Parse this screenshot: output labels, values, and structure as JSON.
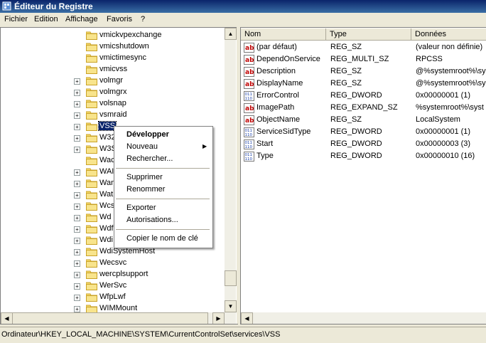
{
  "window": {
    "title": "Éditeur du Registre"
  },
  "menu": [
    "Fichier",
    "Edition",
    "Affichage",
    "Favoris",
    "?"
  ],
  "tree": {
    "items": [
      {
        "label": "vmickvpexchange",
        "expandable": false
      },
      {
        "label": "vmicshutdown",
        "expandable": false
      },
      {
        "label": "vmictimesync",
        "expandable": false
      },
      {
        "label": "vmicvss",
        "expandable": false
      },
      {
        "label": "volmgr",
        "expandable": true
      },
      {
        "label": "volmgrx",
        "expandable": true
      },
      {
        "label": "volsnap",
        "expandable": true
      },
      {
        "label": "vsmraid",
        "expandable": true
      },
      {
        "label": "VSS",
        "expandable": true,
        "selected": true
      },
      {
        "label": "W32",
        "expandable": true
      },
      {
        "label": "W3S",
        "expandable": true
      },
      {
        "label": "Wac",
        "expandable": false
      },
      {
        "label": "WAI",
        "expandable": true
      },
      {
        "label": "Wan",
        "expandable": true
      },
      {
        "label": "Wat",
        "expandable": true
      },
      {
        "label": "Wcs",
        "expandable": true
      },
      {
        "label": "Wd",
        "expandable": true
      },
      {
        "label": "Wdf",
        "expandable": true
      },
      {
        "label": "Wdi",
        "expandable": true
      },
      {
        "label": "WdiSystemHost",
        "expandable": true
      },
      {
        "label": "Wecsvc",
        "expandable": true
      },
      {
        "label": "wercplsupport",
        "expandable": true
      },
      {
        "label": "WerSvc",
        "expandable": true
      },
      {
        "label": "WfpLwf",
        "expandable": true
      },
      {
        "label": "WIMMount",
        "expandable": true
      }
    ]
  },
  "list": {
    "columns": [
      "Nom",
      "Type",
      "Données"
    ],
    "rows": [
      {
        "icon": "string-value-icon",
        "name": "(par défaut)",
        "type": "REG_SZ",
        "data": "(valeur non définie)"
      },
      {
        "icon": "string-value-icon",
        "name": "DependOnService",
        "type": "REG_MULTI_SZ",
        "data": "RPCSS"
      },
      {
        "icon": "string-value-icon",
        "name": "Description",
        "type": "REG_SZ",
        "data": "@%systemroot%\\sy"
      },
      {
        "icon": "string-value-icon",
        "name": "DisplayName",
        "type": "REG_SZ",
        "data": "@%systemroot%\\sy"
      },
      {
        "icon": "binary-value-icon",
        "name": "ErrorControl",
        "type": "REG_DWORD",
        "data": "0x00000001 (1)"
      },
      {
        "icon": "string-value-icon",
        "name": "ImagePath",
        "type": "REG_EXPAND_SZ",
        "data": "%systemroot%\\syst"
      },
      {
        "icon": "string-value-icon",
        "name": "ObjectName",
        "type": "REG_SZ",
        "data": "LocalSystem"
      },
      {
        "icon": "binary-value-icon",
        "name": "ServiceSidType",
        "type": "REG_DWORD",
        "data": "0x00000001 (1)"
      },
      {
        "icon": "binary-value-icon",
        "name": "Start",
        "type": "REG_DWORD",
        "data": "0x00000003 (3)"
      },
      {
        "icon": "binary-value-icon",
        "name": "Type",
        "type": "REG_DWORD",
        "data": "0x00000010 (16)"
      }
    ]
  },
  "context_menu": {
    "items": [
      {
        "label": "Développer",
        "bold": true
      },
      {
        "label": "Nouveau",
        "submenu": true
      },
      {
        "label": "Rechercher..."
      },
      {
        "label": "Supprimer"
      },
      {
        "label": "Renommer"
      },
      {
        "label": "Exporter"
      },
      {
        "label": "Autorisations...",
        "highlighted": true
      },
      {
        "label": "Copier le nom de clé"
      }
    ]
  },
  "statusbar": {
    "path": "Ordinateur\\HKEY_LOCAL_MACHINE\\SYSTEM\\CurrentControlSet\\services\\VSS"
  },
  "colors": {
    "selection": "#0a246a",
    "highlighter": "#e1f000"
  }
}
